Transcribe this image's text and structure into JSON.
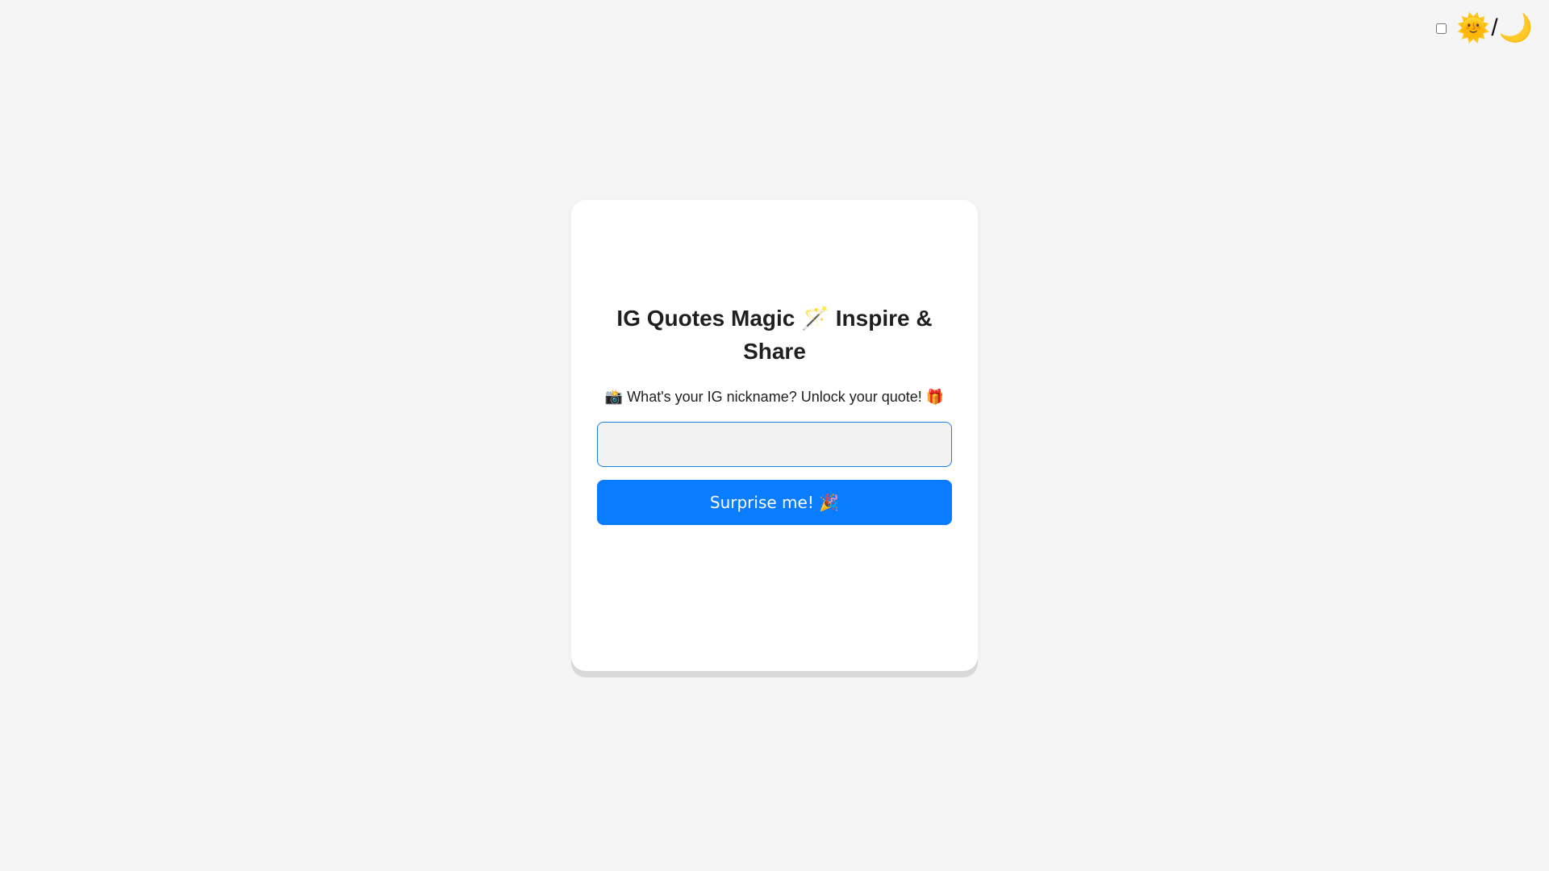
{
  "theme_toggle": {
    "checked": false,
    "sun_icon": "🌞",
    "separator": "/",
    "moon_icon": "🌙"
  },
  "card": {
    "title": "IG Quotes Magic 🪄 Inspire & Share",
    "prompt": "📸 What's your IG nickname? Unlock your quote! 🎁",
    "input": {
      "value": "",
      "placeholder": ""
    },
    "button_label": "Surprise me! 🎉"
  },
  "colors": {
    "background": "#f5f5f5",
    "card": "#ffffff",
    "accent": "#0a7cff",
    "input_border": "#1a7fe6"
  }
}
